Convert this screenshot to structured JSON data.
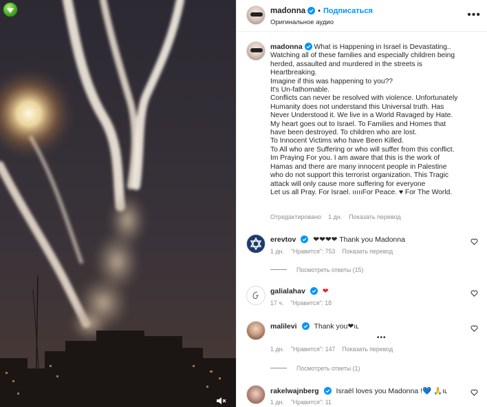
{
  "header": {
    "username": "madonna",
    "follow_label": "Подписаться",
    "audio_label": "Оригинальное аудио",
    "more_label": "•••"
  },
  "caption": {
    "username": "madonna",
    "lines": [
      "What is Happening in Israel is Devastating..",
      "Watching all of these families and especially children being",
      "herded, assaulted and murdered in the streets is",
      "Heartbreaking.",
      "Imagine if this was happening to you??",
      "It's Un-fathomable.",
      "Conflicts can never be resolved with violence. Unfortunately",
      "Humanity does not understand this Universal truth. Has",
      "Never Understood it. We live in a World Ravaged by Hate.",
      "My heart goes out to Israel. To Families and Homes that",
      "have been destroyed. To children who are lost.",
      "To Innocent Victims who have Been Killed.",
      "To All who are Suffering or who will suffer from this conflict.",
      "Im Praying For you. I am aware that this is the work of",
      "Hamas and there are many innocent people in Palestine",
      "who do not support this terrorist organization. This Tragic",
      "attack will only cause more suffering for everyone",
      "Let us all Pray. For Israel. ıııııFor Peace. ♥ For The World."
    ],
    "edited_label": "Отредактировано",
    "time": "1 дн.",
    "translate_label": "Показать перевод"
  },
  "comments": [
    {
      "username": "erevtov",
      "text": "❤❤❤❤ Thank you Madonna",
      "time": "1 дн.",
      "likes": "\"Нравится\": 753",
      "translate": "Показать перевод",
      "replies": "Посмотреть ответы (15)"
    },
    {
      "username": "galialahav",
      "text": "❤",
      "time": "17 ч.",
      "likes": "\"Нравится\": 18"
    },
    {
      "username": "malilevi",
      "text": "Thank you❤ıʟ",
      "time": "1 дн.",
      "likes": "\"Нравится\": 147",
      "translate": "Показать перевод",
      "dots": "•••",
      "replies": "Посмотреть ответы (1)"
    },
    {
      "username": "rakelwajnberg",
      "text": "Israël loves you Madonna !💙 🙏ıʟ",
      "time": "1 дн.",
      "likes": "\"Нравится\": 11"
    }
  ],
  "colors": {
    "accent": "#0095f6",
    "verified": "#0095f6",
    "heart": "#ed1c24",
    "muted": "#8e8e8e"
  },
  "icons": {
    "extension_badge": "green-extension-icon",
    "sound": "speaker-muted-icon",
    "verified": "verified-badge-icon",
    "like": "heart-outline-icon"
  }
}
